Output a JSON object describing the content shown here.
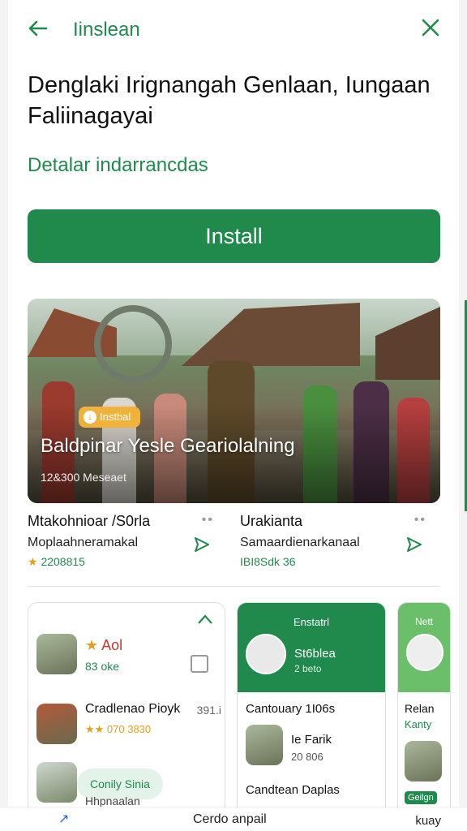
{
  "topbar": {
    "title": "Iinslean"
  },
  "hero_text": {
    "headline": "Denglaki Irignangah Genlaan, Iungaan Faliinagayai",
    "subline": "Detalar indarrancdas",
    "install_label": "Install"
  },
  "hero": {
    "badge": "Instbal",
    "title": "Baldpinar Yesle Geariolalning",
    "sub": "12&300  Meseaet"
  },
  "apps": [
    {
      "name": "Mtakohnioar /S0rla",
      "dev": "Moplaahneramakal",
      "meta": "2208815",
      "more": "••"
    },
    {
      "name": "Urakianta",
      "dev": "Samaardienarkanaal",
      "meta": "IBI8Sdk 36",
      "more": "••"
    }
  ],
  "card1": {
    "row1_name": "Aol",
    "row1_meta": "83 oke",
    "row2_name": "Cradlenao Pioyk",
    "row2_rating": "★★ 070 3830",
    "row2_value": "391.i",
    "pill": "Conily Sinia",
    "row3_dev": "Hhpnaalan"
  },
  "card2": {
    "title": "Enstatrl",
    "name": "St6blea",
    "sub": "2 beto",
    "line1": "Cantouary 1I06s",
    "line2_name": "Ie Farik",
    "line2_meta": "20 806",
    "line3": "Candtean Daplas"
  },
  "card3": {
    "title": "Nett",
    "line1": "Relan",
    "line2": "Kanty",
    "badge": "Geilgn"
  },
  "bottom": {
    "left": "↗",
    "mid": "Cerdo anpail",
    "right": "kuay"
  },
  "colors": {
    "accent": "#1f8a4c",
    "badge": "#f0b23a"
  },
  "icons": [
    "back-arrow-icon",
    "close-icon",
    "share-icon",
    "chevron-up-icon",
    "bookmark-icon"
  ]
}
